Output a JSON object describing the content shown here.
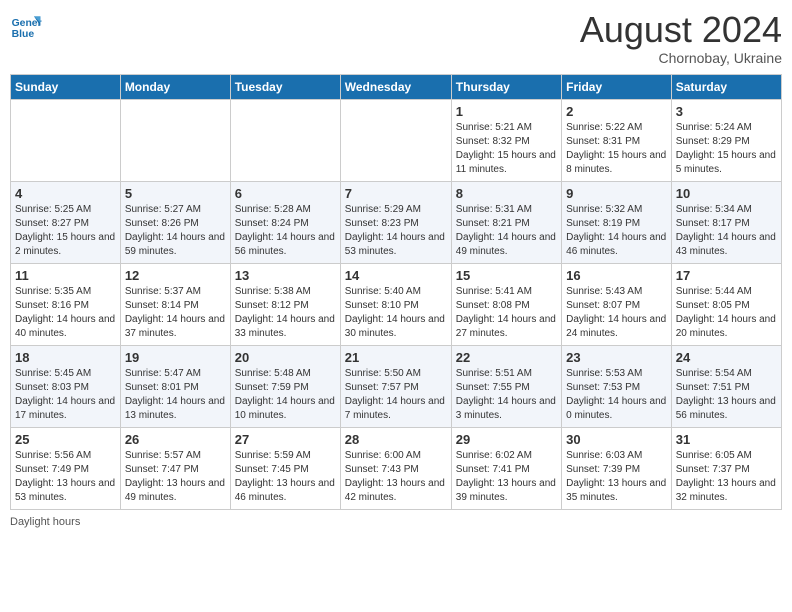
{
  "header": {
    "logo_line1": "General",
    "logo_line2": "Blue",
    "month_year": "August 2024",
    "location": "Chornobay, Ukraine"
  },
  "days_of_week": [
    "Sunday",
    "Monday",
    "Tuesday",
    "Wednesday",
    "Thursday",
    "Friday",
    "Saturday"
  ],
  "weeks": [
    [
      {
        "day": "",
        "info": ""
      },
      {
        "day": "",
        "info": ""
      },
      {
        "day": "",
        "info": ""
      },
      {
        "day": "",
        "info": ""
      },
      {
        "day": "1",
        "info": "Sunrise: 5:21 AM\nSunset: 8:32 PM\nDaylight: 15 hours and 11 minutes."
      },
      {
        "day": "2",
        "info": "Sunrise: 5:22 AM\nSunset: 8:31 PM\nDaylight: 15 hours and 8 minutes."
      },
      {
        "day": "3",
        "info": "Sunrise: 5:24 AM\nSunset: 8:29 PM\nDaylight: 15 hours and 5 minutes."
      }
    ],
    [
      {
        "day": "4",
        "info": "Sunrise: 5:25 AM\nSunset: 8:27 PM\nDaylight: 15 hours and 2 minutes."
      },
      {
        "day": "5",
        "info": "Sunrise: 5:27 AM\nSunset: 8:26 PM\nDaylight: 14 hours and 59 minutes."
      },
      {
        "day": "6",
        "info": "Sunrise: 5:28 AM\nSunset: 8:24 PM\nDaylight: 14 hours and 56 minutes."
      },
      {
        "day": "7",
        "info": "Sunrise: 5:29 AM\nSunset: 8:23 PM\nDaylight: 14 hours and 53 minutes."
      },
      {
        "day": "8",
        "info": "Sunrise: 5:31 AM\nSunset: 8:21 PM\nDaylight: 14 hours and 49 minutes."
      },
      {
        "day": "9",
        "info": "Sunrise: 5:32 AM\nSunset: 8:19 PM\nDaylight: 14 hours and 46 minutes."
      },
      {
        "day": "10",
        "info": "Sunrise: 5:34 AM\nSunset: 8:17 PM\nDaylight: 14 hours and 43 minutes."
      }
    ],
    [
      {
        "day": "11",
        "info": "Sunrise: 5:35 AM\nSunset: 8:16 PM\nDaylight: 14 hours and 40 minutes."
      },
      {
        "day": "12",
        "info": "Sunrise: 5:37 AM\nSunset: 8:14 PM\nDaylight: 14 hours and 37 minutes."
      },
      {
        "day": "13",
        "info": "Sunrise: 5:38 AM\nSunset: 8:12 PM\nDaylight: 14 hours and 33 minutes."
      },
      {
        "day": "14",
        "info": "Sunrise: 5:40 AM\nSunset: 8:10 PM\nDaylight: 14 hours and 30 minutes."
      },
      {
        "day": "15",
        "info": "Sunrise: 5:41 AM\nSunset: 8:08 PM\nDaylight: 14 hours and 27 minutes."
      },
      {
        "day": "16",
        "info": "Sunrise: 5:43 AM\nSunset: 8:07 PM\nDaylight: 14 hours and 24 minutes."
      },
      {
        "day": "17",
        "info": "Sunrise: 5:44 AM\nSunset: 8:05 PM\nDaylight: 14 hours and 20 minutes."
      }
    ],
    [
      {
        "day": "18",
        "info": "Sunrise: 5:45 AM\nSunset: 8:03 PM\nDaylight: 14 hours and 17 minutes."
      },
      {
        "day": "19",
        "info": "Sunrise: 5:47 AM\nSunset: 8:01 PM\nDaylight: 14 hours and 13 minutes."
      },
      {
        "day": "20",
        "info": "Sunrise: 5:48 AM\nSunset: 7:59 PM\nDaylight: 14 hours and 10 minutes."
      },
      {
        "day": "21",
        "info": "Sunrise: 5:50 AM\nSunset: 7:57 PM\nDaylight: 14 hours and 7 minutes."
      },
      {
        "day": "22",
        "info": "Sunrise: 5:51 AM\nSunset: 7:55 PM\nDaylight: 14 hours and 3 minutes."
      },
      {
        "day": "23",
        "info": "Sunrise: 5:53 AM\nSunset: 7:53 PM\nDaylight: 14 hours and 0 minutes."
      },
      {
        "day": "24",
        "info": "Sunrise: 5:54 AM\nSunset: 7:51 PM\nDaylight: 13 hours and 56 minutes."
      }
    ],
    [
      {
        "day": "25",
        "info": "Sunrise: 5:56 AM\nSunset: 7:49 PM\nDaylight: 13 hours and 53 minutes."
      },
      {
        "day": "26",
        "info": "Sunrise: 5:57 AM\nSunset: 7:47 PM\nDaylight: 13 hours and 49 minutes."
      },
      {
        "day": "27",
        "info": "Sunrise: 5:59 AM\nSunset: 7:45 PM\nDaylight: 13 hours and 46 minutes."
      },
      {
        "day": "28",
        "info": "Sunrise: 6:00 AM\nSunset: 7:43 PM\nDaylight: 13 hours and 42 minutes."
      },
      {
        "day": "29",
        "info": "Sunrise: 6:02 AM\nSunset: 7:41 PM\nDaylight: 13 hours and 39 minutes."
      },
      {
        "day": "30",
        "info": "Sunrise: 6:03 AM\nSunset: 7:39 PM\nDaylight: 13 hours and 35 minutes."
      },
      {
        "day": "31",
        "info": "Sunrise: 6:05 AM\nSunset: 7:37 PM\nDaylight: 13 hours and 32 minutes."
      }
    ]
  ],
  "footer": {
    "note": "Daylight hours"
  }
}
